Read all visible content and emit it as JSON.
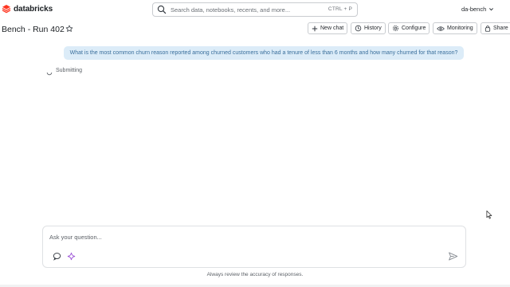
{
  "app": {
    "brand": "databricks",
    "brand_color": "#ff3621"
  },
  "search": {
    "placeholder": "Search data, notebooks, recents, and more...",
    "shortcut": "CTRL + P",
    "icon": "search-icon"
  },
  "workspace": {
    "name": "da-bench",
    "icon": "chevron-down-icon"
  },
  "header": {
    "title": "Bench - Run 402",
    "star_icon": "star-icon"
  },
  "actions": {
    "new_chat": "New chat",
    "history": "History",
    "configure": "Configure",
    "monitoring": "Monitoring",
    "share": "Share"
  },
  "chat": {
    "user_message": "What is the most common churn reason reported among churned customers who had a tenure of less than 6 months and how many churned for that reason?",
    "user_bubble_color": "#dcecf8",
    "status": "Submitting"
  },
  "composer": {
    "placeholder": "Ask your question...",
    "note": "Always review the accuracy of responses."
  }
}
